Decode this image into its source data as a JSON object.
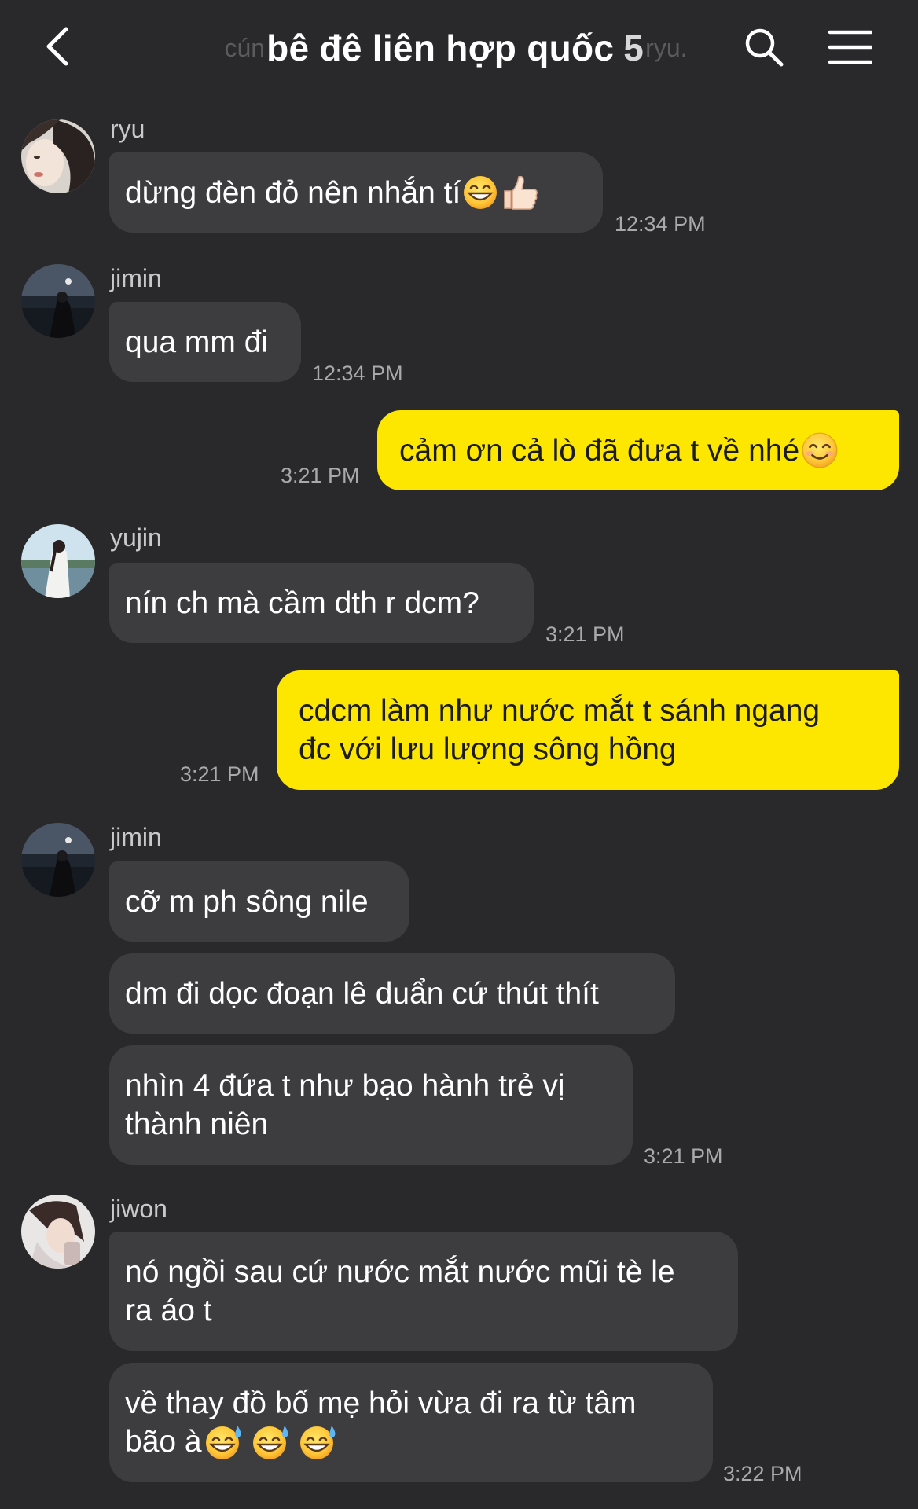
{
  "header": {
    "back_icon": "chevron-left-icon",
    "title": "bê đê liên hợp quốc",
    "member_count": "5",
    "ghost_left": "cún",
    "ghost_right": "ryu.",
    "search_icon": "search-icon",
    "menu_icon": "hamburger-menu-icon"
  },
  "colors": {
    "background": "#29292b",
    "incoming_bubble": "#3d3d40",
    "outgoing_bubble": "#fde700",
    "timestamp": "#a9a9ad"
  },
  "messages": [
    {
      "sender": "ryu",
      "text": "dừng đèn đỏ nên nhắn tí",
      "emojis": [
        "grinning-face-emoji",
        "thumbs-up-emoji"
      ],
      "time": "12:34 PM"
    },
    {
      "sender": "jimin",
      "text": "qua mm đi",
      "time": "12:34 PM"
    },
    {
      "sender": "me",
      "text": "cảm ơn cả lò đã đưa t về nhé",
      "emojis": [
        "smiling-face-emoji"
      ],
      "time": "3:21 PM"
    },
    {
      "sender": "yujin",
      "text": "nín ch mà cầm dth r dcm?",
      "time": "3:21 PM"
    },
    {
      "sender": "me",
      "line1": "cdcm làm như nước mắt t sánh ngang",
      "line2": "đc với lưu lượng sông hồng",
      "time": "3:21 PM"
    },
    {
      "sender": "jimin",
      "text": "cỡ m ph sông nile"
    },
    {
      "text": "dm đi dọc đoạn lê duẩn cứ thút thít"
    },
    {
      "line1": "nhìn 4 đứa t như bạo hành trẻ vị",
      "line2": "thành niên",
      "time": "3:21 PM"
    },
    {
      "sender": "jiwon",
      "line1": "nó ngồi sau cứ nước mắt nước mũi tè le",
      "line2": "ra áo t"
    },
    {
      "line1": "về thay đồ bố mẹ hỏi vừa đi ra từ tâm",
      "line2": "bão à",
      "emojis": [
        "sweat-smile-emoji",
        "sweat-smile-emoji",
        "sweat-smile-emoji"
      ],
      "time": "3:22 PM"
    }
  ]
}
